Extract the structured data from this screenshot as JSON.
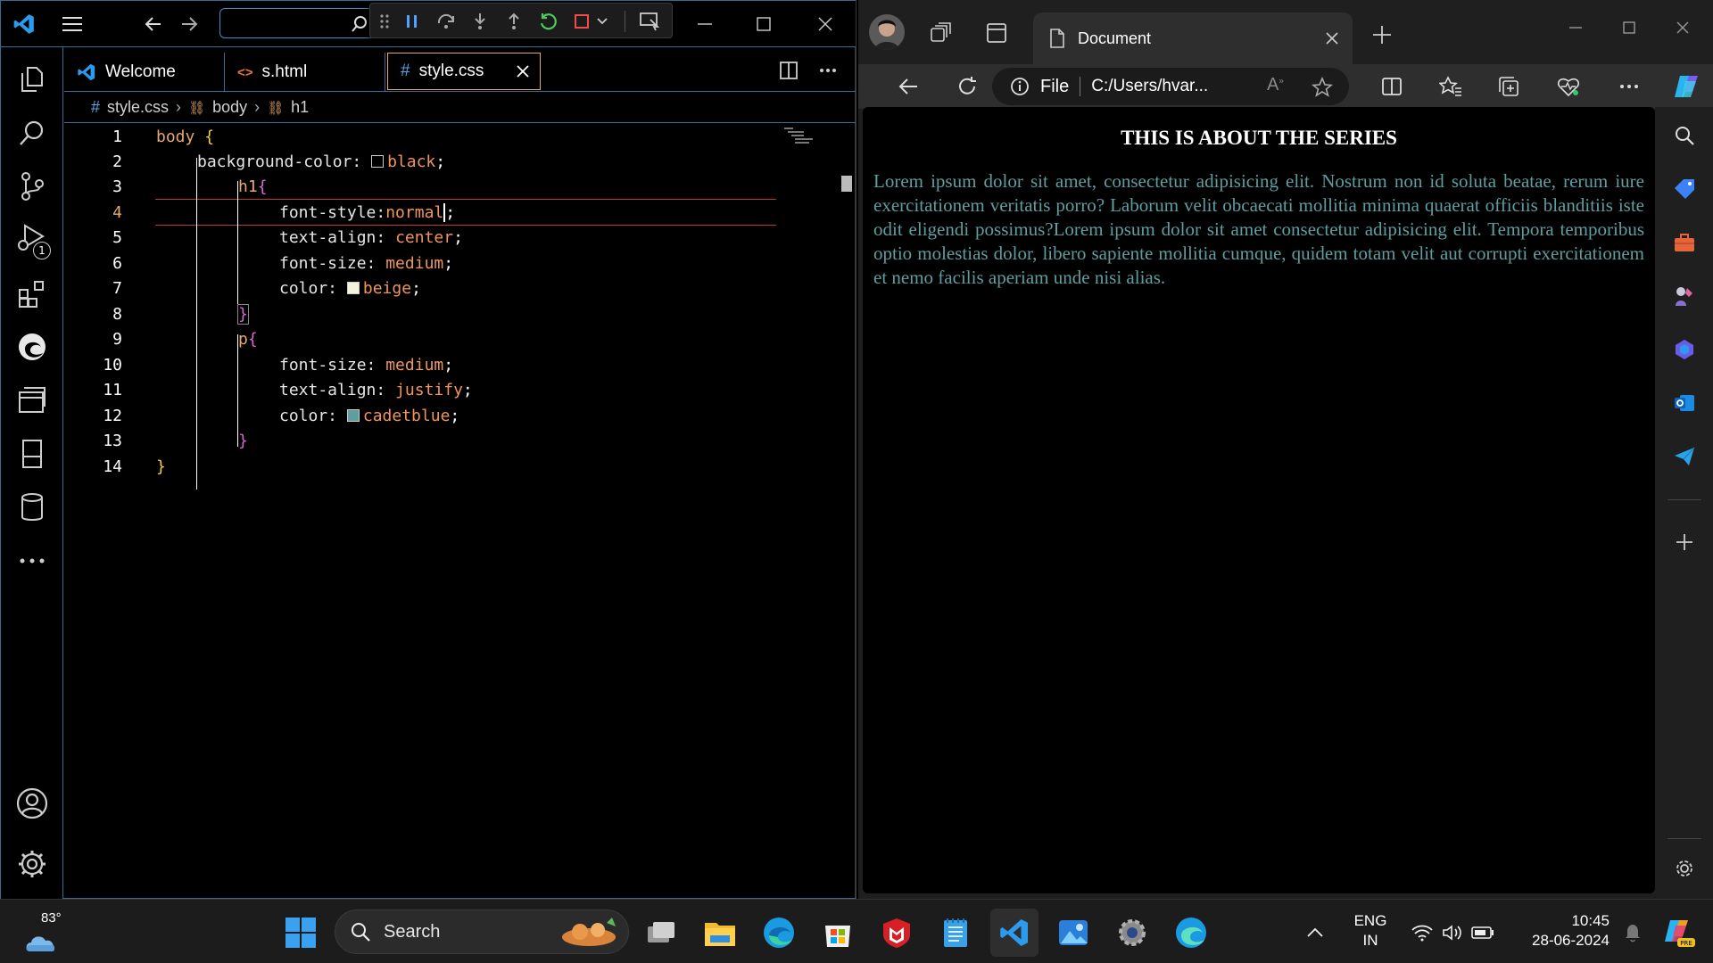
{
  "vscode": {
    "tabs": [
      {
        "label": "Welcome",
        "icon": "vscode-logo-icon"
      },
      {
        "label": "s.html",
        "icon": "html-brackets-icon"
      },
      {
        "label": "style.css",
        "icon": "hash-icon",
        "active": true
      }
    ],
    "breadcrumb": {
      "file": "style.css",
      "items": [
        "body",
        "h1"
      ]
    },
    "run_badge": "1",
    "line_numbers": [
      "1",
      "2",
      "3",
      "4",
      "5",
      "6",
      "7",
      "8",
      "9",
      "10",
      "11",
      "12",
      "13",
      "14"
    ],
    "code": {
      "l1_sel": "body",
      "l1_brace": "{",
      "l2_prop": "background-color:",
      "l2_val": "black",
      "l2_semi": ";",
      "l3_sel": "h1",
      "l3_brace": "{",
      "l4_prop": "font-style:",
      "l4_val": "normal",
      "l4_semi": ";",
      "l5_prop": "text-align:",
      "l5_val": "center",
      "l5_semi": ";",
      "l6_prop": "font-size:",
      "l6_val": "medium",
      "l6_semi": ";",
      "l7_prop": "color:",
      "l7_val": "beige",
      "l7_semi": ";",
      "l8_brace": "}",
      "l9_sel": "p",
      "l9_brace": "{",
      "l10_prop": "font-size:",
      "l10_val": "medium",
      "l10_semi": ";",
      "l11_prop": "text-align:",
      "l11_val": "justify",
      "l11_semi": ";",
      "l12_prop": "color:",
      "l12_val": "cadetblue",
      "l12_semi": ";",
      "l13_brace": "}",
      "l14_brace": "}"
    },
    "swatches": {
      "black": "#000000",
      "beige": "#f5f5dc",
      "cadetblue": "#5f9ea0"
    }
  },
  "edge": {
    "tab_title": "Document",
    "address_scheme": "File",
    "address_path": "C:/Users/hvar...",
    "page": {
      "heading": "THIS IS ABOUT THE SERIES",
      "paragraph": "Lorem ipsum dolor sit amet, consectetur adipisicing elit. Nostrum non id soluta beatae, rerum iure exercitationem veritatis porro? Laborum velit obcaecati mollitia minima quaerat officiis blanditiis iste odit eligendi possimus?Lorem ipsum dolor sit amet consectetur adipisicing elit. Tempora temporibus optio molestias dolor, libero sapiente mollitia cumque, quidem totam velit aut corrupti exercitationem et nemo facilis aperiam unde nisi alias."
    }
  },
  "taskbar": {
    "weather_temp": "83°",
    "search_label": "Search",
    "lang_top": "ENG",
    "lang_bottom": "IN",
    "time": "10:45",
    "date": "28-06-2024",
    "accent": "#0078d4"
  }
}
